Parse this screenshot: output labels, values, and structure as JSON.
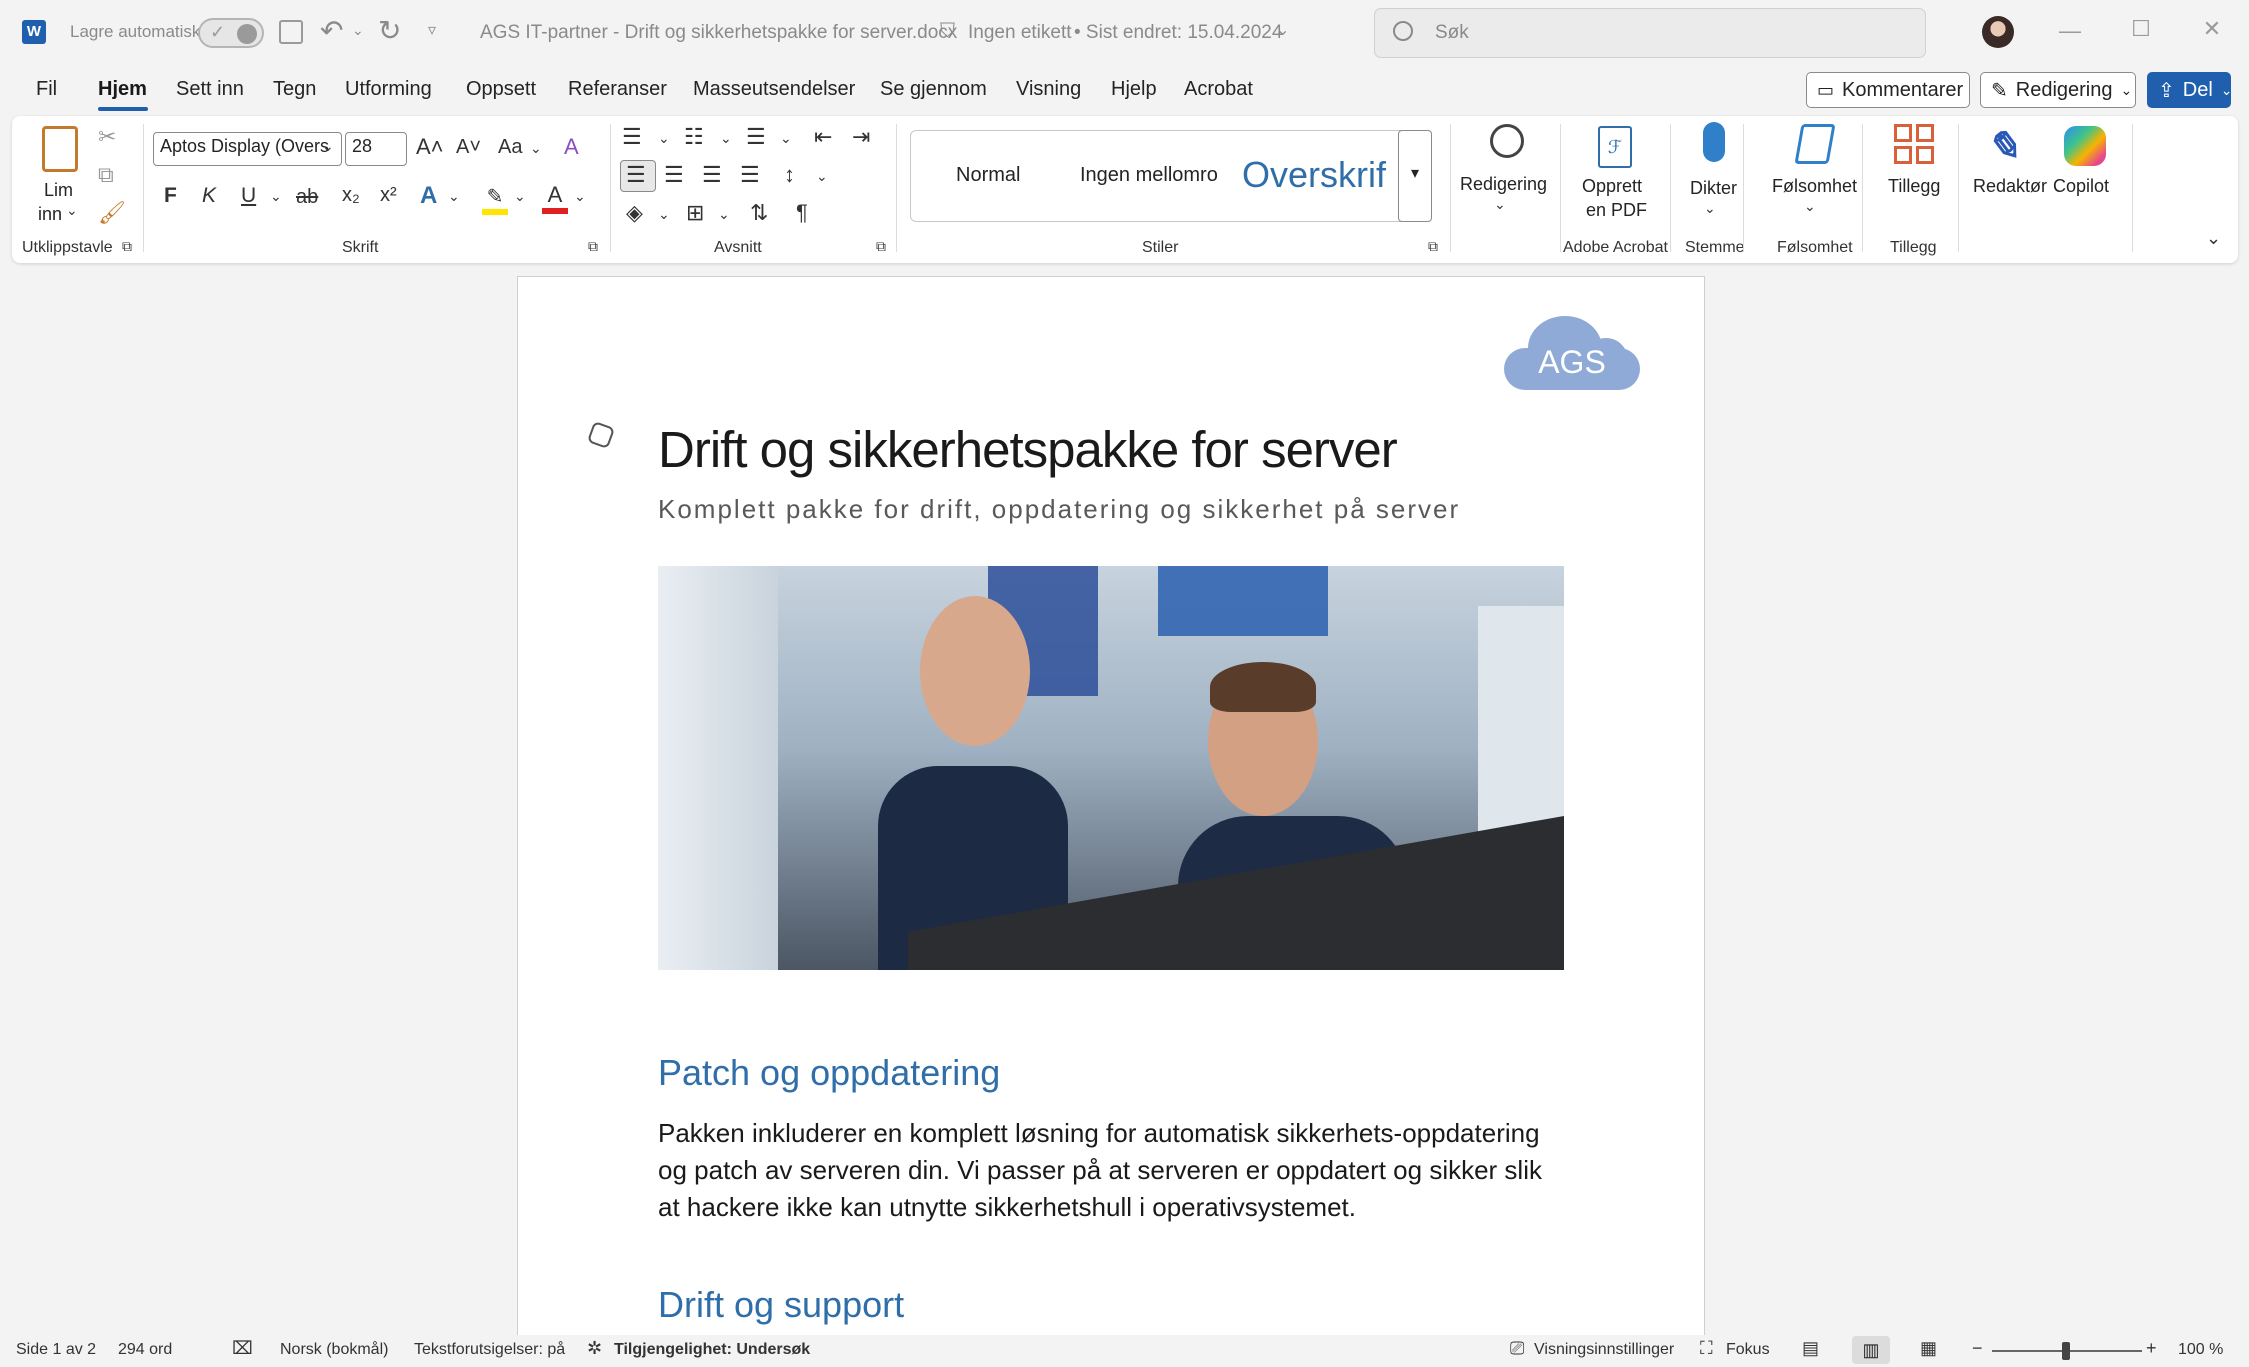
{
  "titlebar": {
    "autosave_label": "Lagre automatisk",
    "document_title": "AGS IT-partner - Drift og sikkerhetspakke for server.docx",
    "label_status": "Ingen etikett",
    "last_modified": "• Sist endret: 15.04.2024",
    "search_placeholder": "Søk"
  },
  "menu": {
    "items": [
      "Fil",
      "Hjem",
      "Sett inn",
      "Tegn",
      "Utforming",
      "Oppsett",
      "Referanser",
      "Masseutsendelser",
      "Se gjennom",
      "Visning",
      "Hjelp",
      "Acrobat"
    ],
    "active": "Hjem",
    "comments_label": "Kommentarer",
    "editing_label": "Redigering",
    "share_label": "Del"
  },
  "ribbon": {
    "clipboard": {
      "paste_label_1": "Lim",
      "paste_label_2": "inn",
      "group_label": "Utklippstavle"
    },
    "font": {
      "font_name": "Aptos Display (Overs",
      "font_size": "28",
      "change_case": "Aa",
      "bold": "F",
      "italic": "K",
      "underline": "U",
      "strike": "ab",
      "subscript": "x₂",
      "superscript": "x²",
      "group_label": "Skrift"
    },
    "paragraph": {
      "group_label": "Avsnitt"
    },
    "styles": {
      "items": [
        "Normal",
        "Ingen mellomro",
        "Overskrif"
      ],
      "group_label": "Stiler"
    },
    "editing": {
      "label": "Redigering"
    },
    "acrobat": {
      "label_1": "Opprett",
      "label_2": "en PDF",
      "group_label": "Adobe Acrobat"
    },
    "voice": {
      "label": "Dikter",
      "group_label": "Stemme"
    },
    "sensitivity": {
      "label": "Følsomhet",
      "group_label": "Følsomhet"
    },
    "addins": {
      "label": "Tillegg",
      "group_label": "Tillegg"
    },
    "editor": {
      "label": "Redaktør"
    },
    "copilot": {
      "label": "Copilot"
    }
  },
  "document": {
    "logo_text": "AGS",
    "title": "Drift og sikkerhetspakke for server",
    "subtitle": "Komplett pakke for drift, oppdatering og sikkerhet på server",
    "heading1": "Patch og oppdatering",
    "paragraph1": "Pakken inkluderer en komplett løsning for automatisk sikkerhets-oppdatering og patch av serveren din. Vi passer på at serveren er oppdatert og sikker slik at hackere ikke kan utnytte sikkerhetshull i operativsystemet.",
    "heading2": "Drift og support"
  },
  "statusbar": {
    "page": "Side 1 av 2",
    "words": "294 ord",
    "language": "Norsk (bokmål)",
    "predictions": "Tekstforutsigelser: på",
    "accessibility": "Tilgjengelighet: Undersøk",
    "display_settings": "Visningsinnstillinger",
    "focus": "Fokus",
    "zoom": "100 %"
  },
  "colors": {
    "accent": "#1f5fae",
    "heading": "#2f6ea9",
    "logo_cloud": "#8faad6"
  }
}
